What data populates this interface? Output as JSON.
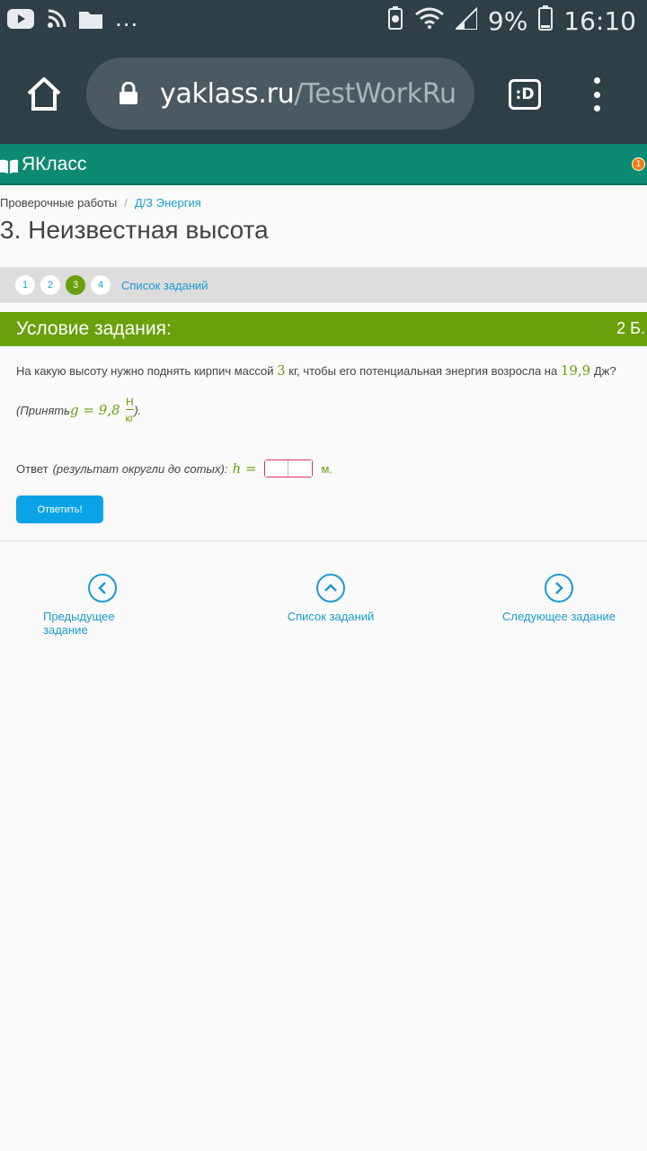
{
  "status_bar": {
    "time": "16:10",
    "battery": "9%",
    "more": "...",
    "icons": [
      "youtube-icon",
      "rss-icon",
      "folder-icon",
      "battery-saver-icon",
      "wifi-icon",
      "signal-icon",
      "battery-icon"
    ]
  },
  "browser": {
    "url_host": "yaklass.ru",
    "url_path": "/TestWorkRu",
    "tabs_label": ":D"
  },
  "site": {
    "logo_text": "ЯКласс",
    "notification_count": "1"
  },
  "breadcrumb": {
    "item1": "Проверочные работы",
    "separator": "/",
    "item2": "Д/З Энергия"
  },
  "page_title": "3. Неизвестная высота",
  "task_nav": {
    "tasks": [
      "1",
      "2",
      "3",
      "4"
    ],
    "active": "3",
    "list_link": "Список заданий"
  },
  "condition": {
    "title": "Условие задания:",
    "points": "2 Б.",
    "question_part1": "На какую высоту нужно поднять кирпич массой ",
    "mass": "3",
    "question_part2": " кг, чтобы его потенциальная энергия возросла на ",
    "energy": "19,9",
    "question_part3": " Дж?",
    "hint_prefix": "(Принять",
    "g_value": "g = 9,8",
    "g_unit_num": "Н",
    "g_unit_den": "кг",
    "hint_suffix": ")."
  },
  "answer": {
    "label": "Ответ",
    "note": "(результат округли до сотых):",
    "variable": "h =",
    "unit": "м.",
    "submit": "Ответить!"
  },
  "bottom_nav": {
    "prev": "Предыдущее задание",
    "list": "Список заданий",
    "next": "Следующее задание"
  },
  "colors": {
    "status_bg": "#2f3f48",
    "header_green": "#0f8a72",
    "condition_green": "#6aa00c",
    "link_blue": "#1a9bd0",
    "button_blue": "#0aa4e6"
  }
}
